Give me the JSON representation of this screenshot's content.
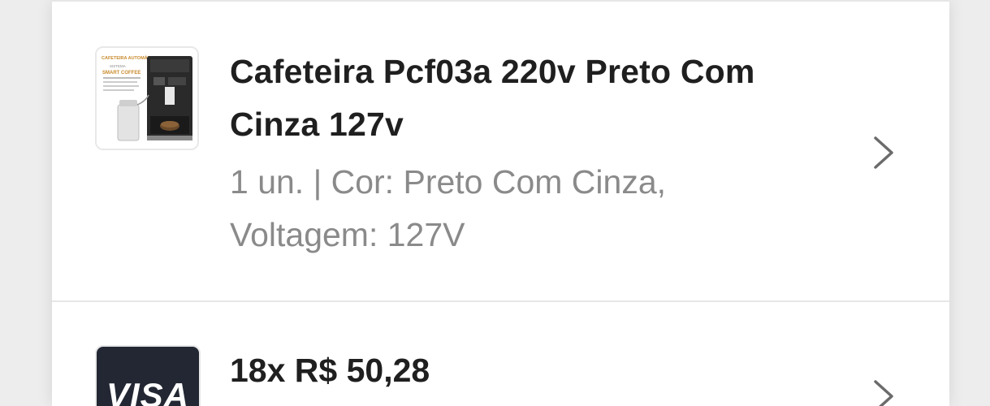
{
  "product": {
    "title": "Cafeteira Pcf03a 220v Preto Com Cinza 127v",
    "details": "1 un. | Cor: Preto Com Cinza, Voltagem: 127V",
    "image_icon": "coffee-machine-thumbnail",
    "image_text": {
      "line1": "CAFETEIRA AUTOMÁTICA",
      "line2": "SISTEMA",
      "line3": "SMART COFFEE"
    }
  },
  "payment": {
    "title": "18x R$ 50,28",
    "brand": "VISA",
    "brand_color": "#222733"
  },
  "icons": {
    "chevron": "chevron-right-icon"
  },
  "colors": {
    "title_text": "#1f1f1f",
    "secondary_text": "#8a8a8a",
    "chevron": "#6b6b6b",
    "background": "#ededed",
    "card": "#ffffff"
  }
}
